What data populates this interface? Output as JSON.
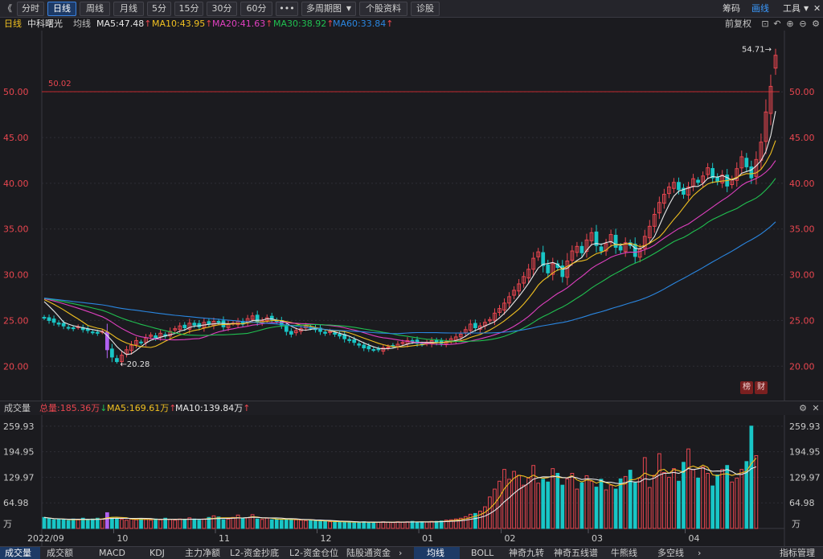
{
  "toolbar": {
    "back_icon": "double-chevron-left-icon",
    "back_glyph": "《",
    "tabs": [
      "分时",
      "日线",
      "周线",
      "月线",
      "5分",
      "15分",
      "30分",
      "60分",
      "•••",
      "多周期图",
      "个股资料",
      "诊股"
    ],
    "active_tab": "日线",
    "right": [
      "筹码",
      "画线",
      "工具"
    ],
    "right_active": "画线"
  },
  "ma_bar": {
    "period": "日线",
    "stock": "中科曙光",
    "kind": "均线",
    "ma5": "MA5:47.48",
    "ma10": "MA10:43.95",
    "ma20": "MA20:41.63",
    "ma30": "MA30:38.92",
    "ma60": "MA60:33.84",
    "adjust": "前复权"
  },
  "colors": {
    "up": "#e8464f",
    "down": "#19c6c6",
    "ma5": "#e8e8e8",
    "ma10": "#f0c020",
    "ma20": "#e040c0",
    "ma30": "#20c050",
    "ma60": "#2a86e0",
    "accent": "#3a82e0",
    "grid": "#2e2e36"
  },
  "price_chart": {
    "hline_label": "50.02",
    "high_label": "54.71",
    "low_label": "20.28",
    "badge1": "榜",
    "badge2": "财"
  },
  "volume": {
    "label": "成交量",
    "total": "总量:185.36万",
    "ma5": "MA5:169.61万",
    "ma10": "MA10:139.84万",
    "unit": "万"
  },
  "bottom_tabs": [
    "成交量",
    "成交额",
    "MACD",
    "KDJ",
    "主力净额",
    "L2-资金抄底",
    "L2-资金仓位",
    "陆股通资金"
  ],
  "bottom_tabs_right": [
    "均线",
    "BOLL",
    "神奇九转",
    "神奇五线谱",
    "牛熊线",
    "多空线",
    "指标管理"
  ],
  "chart_data": [
    {
      "type": "candlestick",
      "title": "中科曙光",
      "ylim": [
        18,
        56
      ],
      "y_ticks": [
        "50.00",
        "45.00",
        "40.00",
        "35.00",
        "30.00",
        "25.00",
        "20.00"
      ],
      "x_ticks": [
        "2022/09",
        "10",
        "11",
        "12",
        "01",
        "02",
        "03",
        "04"
      ],
      "hline": 50.02,
      "high": 54.71,
      "low": 20.28,
      "close_approx": [
        25.3,
        25.0,
        24.8,
        24.6,
        24.4,
        24.2,
        24.1,
        24.3,
        24.0,
        23.9,
        23.7,
        23.6,
        23.8,
        21.8,
        21.0,
        20.5,
        21.2,
        21.8,
        22.3,
        22.8,
        22.6,
        23.1,
        23.4,
        23.1,
        23.6,
        23.3,
        23.8,
        24.1,
        24.4,
        24.2,
        24.7,
        24.5,
        24.3,
        24.8,
        24.6,
        24.9,
        24.8,
        24.3,
        24.6,
        24.7,
        24.9,
        24.6,
        25.2,
        25.5,
        24.9,
        25.0,
        25.3,
        25.1,
        24.9,
        24.5,
        23.8,
        23.5,
        23.9,
        24.1,
        24.4,
        24.2,
        24.0,
        23.8,
        23.6,
        23.8,
        23.5,
        23.3,
        23.0,
        22.8,
        22.6,
        22.3,
        22.0,
        21.9,
        21.8,
        21.8,
        22.0,
        22.1,
        22.2,
        22.4,
        22.6,
        22.8,
        22.7,
        22.5,
        22.4,
        22.6,
        22.8,
        22.6,
        22.5,
        22.7,
        23.0,
        23.2,
        23.5,
        24.0,
        24.6,
        24.2,
        24.4,
        24.8,
        25.1,
        25.8,
        26.3,
        26.9,
        27.6,
        28.3,
        29.0,
        29.8,
        30.6,
        31.8,
        32.5,
        31.0,
        30.2,
        31.2,
        30.8,
        29.8,
        31.5,
        32.6,
        33.1,
        32.4,
        33.8,
        34.6,
        33.2,
        32.6,
        33.4,
        34.4,
        33.0,
        32.7,
        33.5,
        33.2,
        32.0,
        32.8,
        34.2,
        35.3,
        36.6,
        37.9,
        38.8,
        39.6,
        40.1,
        39.3,
        38.8,
        39.6,
        40.5,
        40.1,
        40.8,
        41.7,
        40.6,
        40.2,
        40.9,
        39.7,
        40.4,
        41.6,
        42.9,
        41.8,
        40.6,
        42.6,
        44.5,
        47.8,
        50.6,
        54.0
      ],
      "series": [
        {
          "name": "MA5",
          "value": 47.48
        },
        {
          "name": "MA10",
          "value": 43.95
        },
        {
          "name": "MA20",
          "value": 41.63
        },
        {
          "name": "MA30",
          "value": 38.92
        },
        {
          "name": "MA60",
          "value": 33.84
        }
      ]
    },
    {
      "type": "bar",
      "title": "成交量",
      "ylim": [
        0,
        280
      ],
      "y_ticks": [
        "259.93",
        "194.95",
        "129.97",
        "64.98"
      ],
      "volume_approx": [
        28,
        25,
        22,
        23,
        22,
        20,
        24,
        22,
        26,
        21,
        24,
        26,
        24,
        40,
        27,
        25,
        23,
        21,
        24,
        22,
        25,
        23,
        21,
        24,
        22,
        26,
        23,
        21,
        24,
        22,
        27,
        24,
        21,
        24,
        28,
        32,
        29,
        22,
        24,
        28,
        34,
        25,
        27,
        35,
        24,
        23,
        26,
        22,
        24,
        21,
        23,
        24,
        22,
        21,
        20,
        21,
        19,
        18,
        18,
        17,
        16,
        17,
        17,
        16,
        15,
        15,
        17,
        16,
        15,
        16,
        17,
        16,
        15,
        17,
        16,
        17,
        18,
        16,
        17,
        16,
        18,
        18,
        19,
        21,
        22,
        24,
        26,
        30,
        36,
        38,
        44,
        55,
        80,
        100,
        120,
        150,
        125,
        145,
        135,
        110,
        128,
        160,
        115,
        125,
        118,
        152,
        140,
        110,
        126,
        140,
        100,
        116,
        134,
        120,
        105,
        125,
        98,
        110,
        100,
        126,
        132,
        148,
        116,
        128,
        180,
        104,
        135,
        190,
        142,
        130,
        152,
        120,
        168,
        202,
        150,
        128,
        156,
        140,
        108,
        136,
        150,
        160,
        118,
        128,
        150,
        170,
        260,
        185
      ],
      "series": [
        {
          "name": "MA5",
          "value": 169.61
        },
        {
          "name": "MA10",
          "value": 139.84
        }
      ]
    }
  ]
}
